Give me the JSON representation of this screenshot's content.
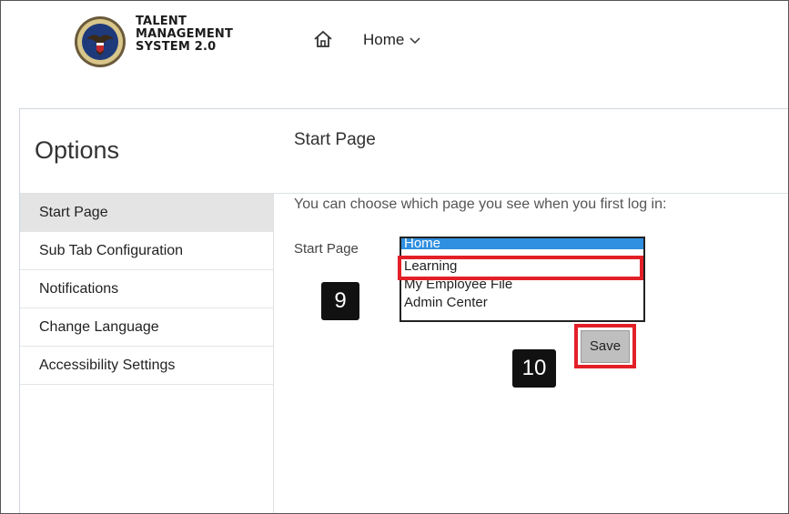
{
  "header": {
    "brand_line1": "TALENT",
    "brand_line2": "MANAGEMENT",
    "brand_line3": "SYSTEM 2.0",
    "home_label": "Home"
  },
  "options": {
    "title": "Options",
    "sidebar": {
      "items": [
        {
          "label": "Start Page",
          "active": true
        },
        {
          "label": "Sub Tab Configuration"
        },
        {
          "label": "Notifications"
        },
        {
          "label": "Change Language"
        },
        {
          "label": "Accessibility Settings"
        }
      ]
    },
    "content": {
      "heading": "Start Page",
      "description": "You can choose which page you see when you first log in:",
      "field_label": "Start Page",
      "listbox_options": [
        "Home",
        "Learning",
        "My Employee File",
        "Admin Center"
      ],
      "selected_option": "Home",
      "save_label": "Save"
    }
  },
  "annotations": {
    "step_9": "9",
    "step_10": "10",
    "highlight_color": "#e32028"
  },
  "colors": {
    "selection_blue": "#2f8fe0",
    "active_sidebar_bg": "#e4e4e4"
  },
  "icons": {
    "logo": "va-seal-icon",
    "home": "home-icon",
    "dropdown": "chevron-down-icon"
  }
}
